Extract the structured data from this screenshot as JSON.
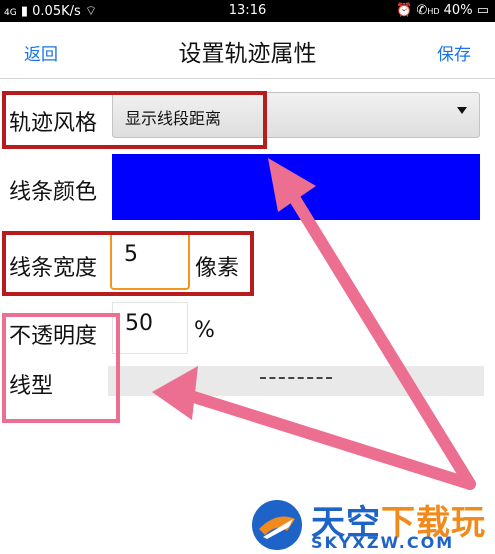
{
  "status_bar": {
    "signal": "4G",
    "network_speed": "0.05K/s",
    "time": "13:16",
    "hd_badge": "HD",
    "battery": "40%"
  },
  "nav": {
    "back_label": "返回",
    "title": "设置轨迹属性",
    "save_label": "保存",
    "link_color": "#1a73e8"
  },
  "form": {
    "track_style": {
      "label": "轨迹风格",
      "value": "显示线段距离"
    },
    "line_color": {
      "label": "线条颜色",
      "value": "#0000ff"
    },
    "line_width": {
      "label": "线条宽度",
      "value": "5",
      "unit": "像素"
    },
    "opacity": {
      "label": "不透明度",
      "value": "50",
      "unit": "%"
    },
    "line_type": {
      "label": "线型",
      "value": "dashed"
    }
  },
  "annotation_colors": {
    "red": "#b91c1c",
    "pink": "#ec6f91"
  },
  "watermark": {
    "title_part1": "天空",
    "title_part2": "下载玩",
    "subtitle": "SKYXZW.COM"
  }
}
